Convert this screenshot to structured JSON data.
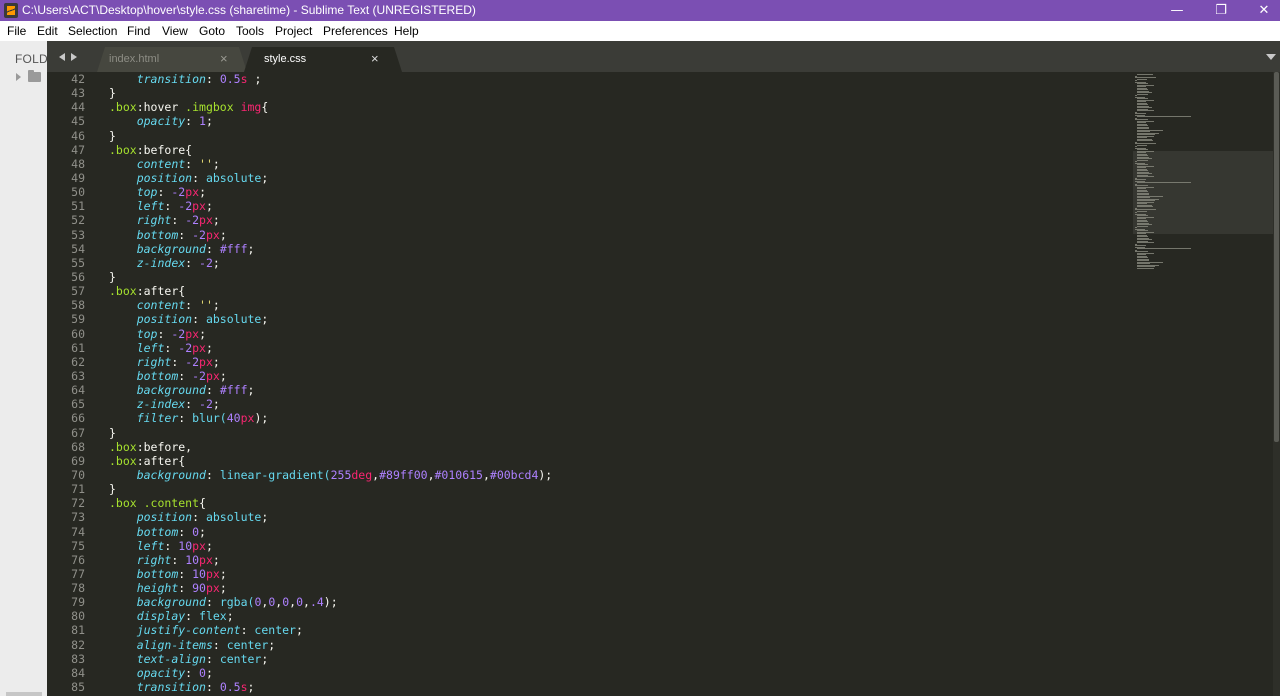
{
  "window": {
    "title": "C:\\Users\\ACT\\Desktop\\hover\\style.css (sharetime) - Sublime Text (UNREGISTERED)",
    "minimize_glyph": "—",
    "maximize_glyph": "❐",
    "close_glyph": "✕"
  },
  "menu": [
    "File",
    "Edit",
    "Selection",
    "Find",
    "View",
    "Goto",
    "Tools",
    "Project",
    "Preferences",
    "Help"
  ],
  "sidebar": {
    "label": "FOLD"
  },
  "tabs": [
    {
      "label": "index.html",
      "close": "×"
    },
    {
      "label": "style.css",
      "close": "×"
    }
  ],
  "editor": {
    "lines": [
      {
        "n": "42",
        "t": [
          [
            "    ",
            "plain"
          ],
          [
            "transition",
            "prop"
          ],
          [
            ": ",
            "plain"
          ],
          [
            "0.5",
            "num"
          ],
          [
            "s",
            "unit"
          ],
          [
            " ;",
            "plain"
          ]
        ]
      },
      {
        "n": "43",
        "t": [
          [
            "}",
            "plain"
          ]
        ]
      },
      {
        "n": "44",
        "t": [
          [
            ".box",
            "selector"
          ],
          [
            ":hover",
            "plain"
          ],
          [
            " .imgbox ",
            "selector"
          ],
          [
            "img",
            "tag"
          ],
          [
            "{",
            "plain"
          ]
        ]
      },
      {
        "n": "45",
        "t": [
          [
            "    ",
            "plain"
          ],
          [
            "opacity",
            "prop"
          ],
          [
            ": ",
            "plain"
          ],
          [
            "1",
            "num"
          ],
          [
            ";",
            "plain"
          ]
        ]
      },
      {
        "n": "46",
        "t": [
          [
            "}",
            "plain"
          ]
        ]
      },
      {
        "n": "47",
        "t": [
          [
            ".box",
            "selector"
          ],
          [
            ":before",
            "plain"
          ],
          [
            "{",
            "plain"
          ]
        ]
      },
      {
        "n": "48",
        "t": [
          [
            "    ",
            "plain"
          ],
          [
            "content",
            "prop"
          ],
          [
            ": ",
            "plain"
          ],
          [
            "''",
            "str"
          ],
          [
            ";",
            "plain"
          ]
        ]
      },
      {
        "n": "49",
        "t": [
          [
            "    ",
            "plain"
          ],
          [
            "position",
            "prop"
          ],
          [
            ": ",
            "plain"
          ],
          [
            "absolute",
            "kw"
          ],
          [
            ";",
            "plain"
          ]
        ]
      },
      {
        "n": "50",
        "t": [
          [
            "    ",
            "plain"
          ],
          [
            "top",
            "prop"
          ],
          [
            ": ",
            "plain"
          ],
          [
            "-2",
            "num"
          ],
          [
            "px",
            "unit"
          ],
          [
            ";",
            "plain"
          ]
        ]
      },
      {
        "n": "51",
        "t": [
          [
            "    ",
            "plain"
          ],
          [
            "left",
            "prop"
          ],
          [
            ": ",
            "plain"
          ],
          [
            "-2",
            "num"
          ],
          [
            "px",
            "unit"
          ],
          [
            ";",
            "plain"
          ]
        ]
      },
      {
        "n": "52",
        "t": [
          [
            "    ",
            "plain"
          ],
          [
            "right",
            "prop"
          ],
          [
            ": ",
            "plain"
          ],
          [
            "-2",
            "num"
          ],
          [
            "px",
            "unit"
          ],
          [
            ";",
            "plain"
          ]
        ]
      },
      {
        "n": "53",
        "t": [
          [
            "    ",
            "plain"
          ],
          [
            "bottom",
            "prop"
          ],
          [
            ": ",
            "plain"
          ],
          [
            "-2",
            "num"
          ],
          [
            "px",
            "unit"
          ],
          [
            ";",
            "plain"
          ]
        ]
      },
      {
        "n": "54",
        "t": [
          [
            "    ",
            "plain"
          ],
          [
            "background",
            "prop"
          ],
          [
            ": ",
            "plain"
          ],
          [
            "#fff",
            "num"
          ],
          [
            ";",
            "plain"
          ]
        ]
      },
      {
        "n": "55",
        "t": [
          [
            "    ",
            "plain"
          ],
          [
            "z-index",
            "prop"
          ],
          [
            ": ",
            "plain"
          ],
          [
            "-2",
            "num"
          ],
          [
            ";",
            "plain"
          ]
        ]
      },
      {
        "n": "56",
        "t": [
          [
            "}",
            "plain"
          ]
        ]
      },
      {
        "n": "57",
        "t": [
          [
            ".box",
            "selector"
          ],
          [
            ":after",
            "plain"
          ],
          [
            "{",
            "plain"
          ]
        ]
      },
      {
        "n": "58",
        "t": [
          [
            "    ",
            "plain"
          ],
          [
            "content",
            "prop"
          ],
          [
            ": ",
            "plain"
          ],
          [
            "''",
            "str"
          ],
          [
            ";",
            "plain"
          ]
        ]
      },
      {
        "n": "59",
        "t": [
          [
            "    ",
            "plain"
          ],
          [
            "position",
            "prop"
          ],
          [
            ": ",
            "plain"
          ],
          [
            "absolute",
            "kw"
          ],
          [
            ";",
            "plain"
          ]
        ]
      },
      {
        "n": "60",
        "t": [
          [
            "    ",
            "plain"
          ],
          [
            "top",
            "prop"
          ],
          [
            ": ",
            "plain"
          ],
          [
            "-2",
            "num"
          ],
          [
            "px",
            "unit"
          ],
          [
            ";",
            "plain"
          ]
        ]
      },
      {
        "n": "61",
        "t": [
          [
            "    ",
            "plain"
          ],
          [
            "left",
            "prop"
          ],
          [
            ": ",
            "plain"
          ],
          [
            "-2",
            "num"
          ],
          [
            "px",
            "unit"
          ],
          [
            ";",
            "plain"
          ]
        ]
      },
      {
        "n": "62",
        "t": [
          [
            "    ",
            "plain"
          ],
          [
            "right",
            "prop"
          ],
          [
            ": ",
            "plain"
          ],
          [
            "-2",
            "num"
          ],
          [
            "px",
            "unit"
          ],
          [
            ";",
            "plain"
          ]
        ]
      },
      {
        "n": "63",
        "t": [
          [
            "    ",
            "plain"
          ],
          [
            "bottom",
            "prop"
          ],
          [
            ": ",
            "plain"
          ],
          [
            "-2",
            "num"
          ],
          [
            "px",
            "unit"
          ],
          [
            ";",
            "plain"
          ]
        ]
      },
      {
        "n": "64",
        "t": [
          [
            "    ",
            "plain"
          ],
          [
            "background",
            "prop"
          ],
          [
            ": ",
            "plain"
          ],
          [
            "#fff",
            "num"
          ],
          [
            ";",
            "plain"
          ]
        ]
      },
      {
        "n": "65",
        "t": [
          [
            "    ",
            "plain"
          ],
          [
            "z-index",
            "prop"
          ],
          [
            ": ",
            "plain"
          ],
          [
            "-2",
            "num"
          ],
          [
            ";",
            "plain"
          ]
        ]
      },
      {
        "n": "66",
        "t": [
          [
            "    ",
            "plain"
          ],
          [
            "filter",
            "prop"
          ],
          [
            ": ",
            "plain"
          ],
          [
            "blur(",
            "kw"
          ],
          [
            "40",
            "num"
          ],
          [
            "px",
            "unit"
          ],
          [
            ");",
            "plain"
          ]
        ]
      },
      {
        "n": "67",
        "t": [
          [
            "}",
            "plain"
          ]
        ]
      },
      {
        "n": "68",
        "t": [
          [
            ".box",
            "selector"
          ],
          [
            ":before,",
            "plain"
          ]
        ]
      },
      {
        "n": "69",
        "t": [
          [
            ".box",
            "selector"
          ],
          [
            ":after",
            "plain"
          ],
          [
            "{",
            "plain"
          ]
        ]
      },
      {
        "n": "70",
        "t": [
          [
            "    ",
            "plain"
          ],
          [
            "background",
            "prop"
          ],
          [
            ": ",
            "plain"
          ],
          [
            "linear-gradient(",
            "kw"
          ],
          [
            "255",
            "num"
          ],
          [
            "deg",
            "unit"
          ],
          [
            ",",
            "plain"
          ],
          [
            "#89ff00",
            "num"
          ],
          [
            ",",
            "plain"
          ],
          [
            "#010615",
            "num"
          ],
          [
            ",",
            "plain"
          ],
          [
            "#00bcd4",
            "num"
          ],
          [
            ");",
            "plain"
          ]
        ]
      },
      {
        "n": "71",
        "t": [
          [
            "}",
            "plain"
          ]
        ]
      },
      {
        "n": "72",
        "t": [
          [
            ".box .content",
            "selector"
          ],
          [
            "{",
            "plain"
          ]
        ]
      },
      {
        "n": "73",
        "t": [
          [
            "    ",
            "plain"
          ],
          [
            "position",
            "prop"
          ],
          [
            ": ",
            "plain"
          ],
          [
            "absolute",
            "kw"
          ],
          [
            ";",
            "plain"
          ]
        ]
      },
      {
        "n": "74",
        "t": [
          [
            "    ",
            "plain"
          ],
          [
            "bottom",
            "prop"
          ],
          [
            ": ",
            "plain"
          ],
          [
            "0",
            "num"
          ],
          [
            ";",
            "plain"
          ]
        ]
      },
      {
        "n": "75",
        "t": [
          [
            "    ",
            "plain"
          ],
          [
            "left",
            "prop"
          ],
          [
            ": ",
            "plain"
          ],
          [
            "10",
            "num"
          ],
          [
            "px",
            "unit"
          ],
          [
            ";",
            "plain"
          ]
        ]
      },
      {
        "n": "76",
        "t": [
          [
            "    ",
            "plain"
          ],
          [
            "right",
            "prop"
          ],
          [
            ": ",
            "plain"
          ],
          [
            "10",
            "num"
          ],
          [
            "px",
            "unit"
          ],
          [
            ";",
            "plain"
          ]
        ]
      },
      {
        "n": "77",
        "t": [
          [
            "    ",
            "plain"
          ],
          [
            "bottom",
            "prop"
          ],
          [
            ": ",
            "plain"
          ],
          [
            "10",
            "num"
          ],
          [
            "px",
            "unit"
          ],
          [
            ";",
            "plain"
          ]
        ]
      },
      {
        "n": "78",
        "t": [
          [
            "    ",
            "plain"
          ],
          [
            "height",
            "prop"
          ],
          [
            ": ",
            "plain"
          ],
          [
            "90",
            "num"
          ],
          [
            "px",
            "unit"
          ],
          [
            ";",
            "plain"
          ]
        ]
      },
      {
        "n": "79",
        "t": [
          [
            "    ",
            "plain"
          ],
          [
            "background",
            "prop"
          ],
          [
            ": ",
            "plain"
          ],
          [
            "rgba(",
            "kw"
          ],
          [
            "0",
            "num"
          ],
          [
            ",",
            "plain"
          ],
          [
            "0",
            "num"
          ],
          [
            ",",
            "plain"
          ],
          [
            "0",
            "num"
          ],
          [
            ",",
            "plain"
          ],
          [
            "0",
            "num"
          ],
          [
            ",",
            "plain"
          ],
          [
            ".4",
            "num"
          ],
          [
            ");",
            "plain"
          ]
        ]
      },
      {
        "n": "80",
        "t": [
          [
            "    ",
            "plain"
          ],
          [
            "display",
            "prop"
          ],
          [
            ": ",
            "plain"
          ],
          [
            "flex",
            "kw"
          ],
          [
            ";",
            "plain"
          ]
        ]
      },
      {
        "n": "81",
        "t": [
          [
            "    ",
            "plain"
          ],
          [
            "justify-content",
            "prop"
          ],
          [
            ": ",
            "plain"
          ],
          [
            "center",
            "kw"
          ],
          [
            ";",
            "plain"
          ]
        ]
      },
      {
        "n": "82",
        "t": [
          [
            "    ",
            "plain"
          ],
          [
            "align-items",
            "prop"
          ],
          [
            ": ",
            "plain"
          ],
          [
            "center",
            "kw"
          ],
          [
            ";",
            "plain"
          ]
        ]
      },
      {
        "n": "83",
        "t": [
          [
            "    ",
            "plain"
          ],
          [
            "text-align",
            "prop"
          ],
          [
            ": ",
            "plain"
          ],
          [
            "center",
            "kw"
          ],
          [
            ";",
            "plain"
          ]
        ]
      },
      {
        "n": "84",
        "t": [
          [
            "    ",
            "plain"
          ],
          [
            "opacity",
            "prop"
          ],
          [
            ": ",
            "plain"
          ],
          [
            "0",
            "num"
          ],
          [
            ";",
            "plain"
          ]
        ]
      },
      {
        "n": "85",
        "t": [
          [
            "    ",
            "plain"
          ],
          [
            "transition",
            "prop"
          ],
          [
            ": ",
            "plain"
          ],
          [
            "0.5",
            "num"
          ],
          [
            "s",
            "unit"
          ],
          [
            ";",
            "plain"
          ]
        ]
      }
    ]
  },
  "theme": {
    "titlebar_bg": "#7b4fb3",
    "editor_bg": "#272822",
    "tab_active_bg": "#272822",
    "tab_inactive_bg": "#46473f"
  }
}
